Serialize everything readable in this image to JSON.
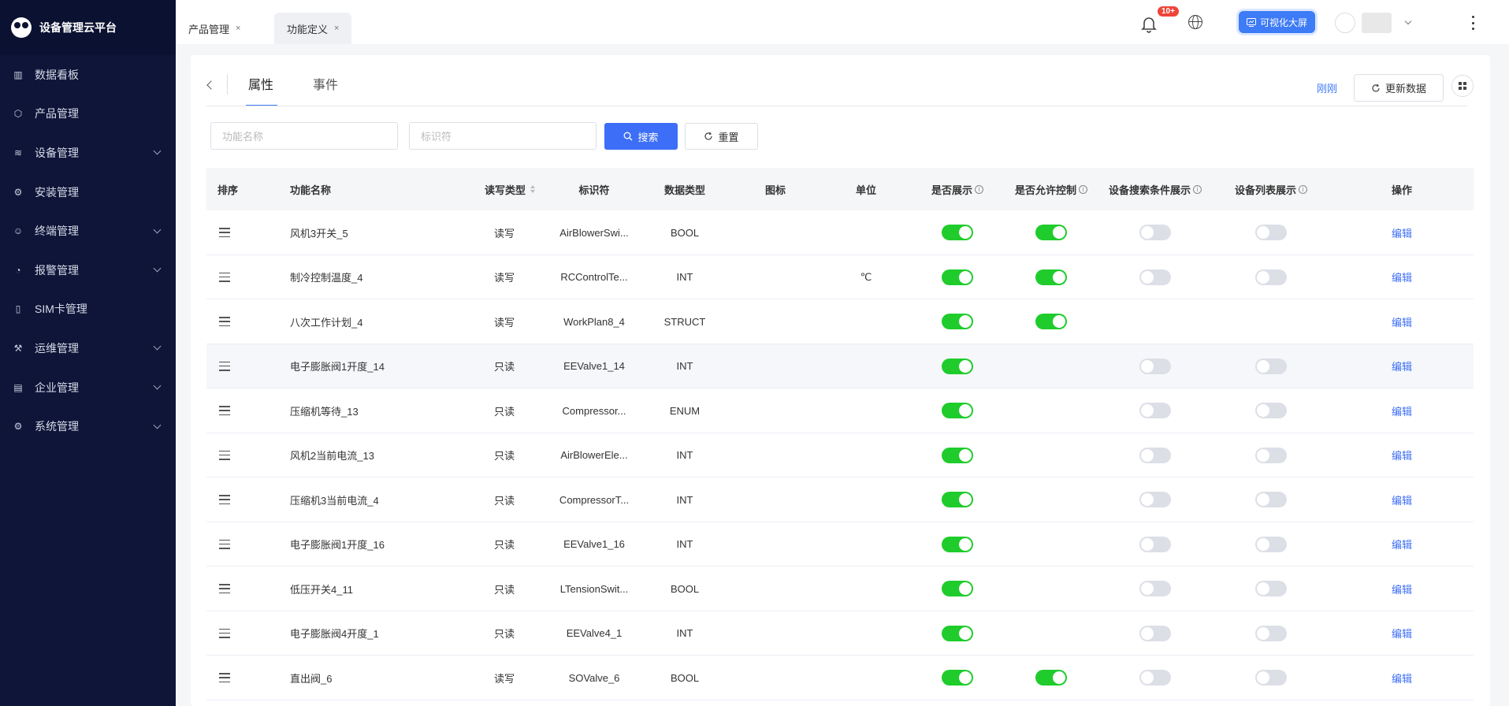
{
  "app": {
    "title": "设备管理云平台"
  },
  "sidebar": {
    "items": [
      {
        "label": "数据看板",
        "icon": "bar-chart-icon",
        "expandable": false
      },
      {
        "label": "产品管理",
        "icon": "cube-icon",
        "expandable": false
      },
      {
        "label": "设备管理",
        "icon": "layers-icon",
        "expandable": true
      },
      {
        "label": "安装管理",
        "icon": "wrench-icon",
        "expandable": false
      },
      {
        "label": "终端管理",
        "icon": "user-icon",
        "expandable": true
      },
      {
        "label": "报警管理",
        "icon": "alarm-icon",
        "expandable": true
      },
      {
        "label": "SIM卡管理",
        "icon": "sim-card-icon",
        "expandable": false
      },
      {
        "label": "运维管理",
        "icon": "tools-icon",
        "expandable": true
      },
      {
        "label": "企业管理",
        "icon": "building-icon",
        "expandable": true
      },
      {
        "label": "系统管理",
        "icon": "gear-icon",
        "expandable": true
      }
    ]
  },
  "topbar": {
    "tabs": [
      {
        "label": "产品管理",
        "close": "×"
      },
      {
        "label": "功能定义",
        "close": "×"
      }
    ],
    "notification_badge": "10+",
    "bigscreen_label": "可视化大屏"
  },
  "content": {
    "subtabs": {
      "properties": "属性",
      "events": "事件"
    },
    "refresh_time": "刚刚",
    "refresh_label": "更新数据",
    "filters": {
      "name_placeholder": "功能名称",
      "identifier_placeholder": "标识符",
      "search_label": "搜索",
      "reset_label": "重置"
    },
    "columns": {
      "order": "排序",
      "name": "功能名称",
      "rw_type": "读写类型",
      "identifier": "标识符",
      "data_type": "数据类型",
      "icon": "图标",
      "unit": "单位",
      "display": "是否展示",
      "control": "是否允许控制",
      "search_display": "设备搜索条件展示",
      "list_display": "设备列表展示",
      "action": "操作"
    },
    "rows": [
      {
        "name": "风机3开关_5",
        "rw": "读写",
        "identifier": "AirBlowerSwi...",
        "type": "BOOL",
        "unit": "",
        "display": "on",
        "control": "on",
        "search": "off",
        "list": "off",
        "action": "编辑"
      },
      {
        "name": "制冷控制温度_4",
        "rw": "读写",
        "identifier": "RCControlTe...",
        "type": "INT",
        "unit": "℃",
        "display": "on",
        "control": "on",
        "search": "off",
        "list": "off",
        "action": "编辑"
      },
      {
        "name": "八次工作计划_4",
        "rw": "读写",
        "identifier": "WorkPlan8_4",
        "type": "STRUCT",
        "unit": "",
        "display": "on",
        "control": "on",
        "search": "none",
        "list": "none",
        "action": "编辑"
      },
      {
        "name": "电子膨胀阀1开度_14",
        "rw": "只读",
        "identifier": "EEValve1_14",
        "type": "INT",
        "unit": "",
        "display": "on",
        "control": "none",
        "search": "off",
        "list": "off",
        "action": "编辑"
      },
      {
        "name": "压缩机等待_13",
        "rw": "只读",
        "identifier": "Compressor...",
        "type": "ENUM",
        "unit": "",
        "display": "on",
        "control": "none",
        "search": "off",
        "list": "off",
        "action": "编辑"
      },
      {
        "name": "风机2当前电流_13",
        "rw": "只读",
        "identifier": "AirBlowerEle...",
        "type": "INT",
        "unit": "",
        "display": "on",
        "control": "none",
        "search": "off",
        "list": "off",
        "action": "编辑"
      },
      {
        "name": "压缩机3当前电流_4",
        "rw": "只读",
        "identifier": "CompressorT...",
        "type": "INT",
        "unit": "",
        "display": "on",
        "control": "none",
        "search": "off",
        "list": "off",
        "action": "编辑"
      },
      {
        "name": "电子膨胀阀1开度_16",
        "rw": "只读",
        "identifier": "EEValve1_16",
        "type": "INT",
        "unit": "",
        "display": "on",
        "control": "none",
        "search": "off",
        "list": "off",
        "action": "编辑"
      },
      {
        "name": "低压开关4_11",
        "rw": "只读",
        "identifier": "LTensionSwit...",
        "type": "BOOL",
        "unit": "",
        "display": "on",
        "control": "none",
        "search": "off",
        "list": "off",
        "action": "编辑"
      },
      {
        "name": "电子膨胀阀4开度_1",
        "rw": "只读",
        "identifier": "EEValve4_1",
        "type": "INT",
        "unit": "",
        "display": "on",
        "control": "none",
        "search": "off",
        "list": "off",
        "action": "编辑"
      },
      {
        "name": "直出阀_6",
        "rw": "读写",
        "identifier": "SOValve_6",
        "type": "BOOL",
        "unit": "",
        "display": "on",
        "control": "on",
        "search": "off",
        "list": "off",
        "action": "编辑"
      }
    ]
  }
}
